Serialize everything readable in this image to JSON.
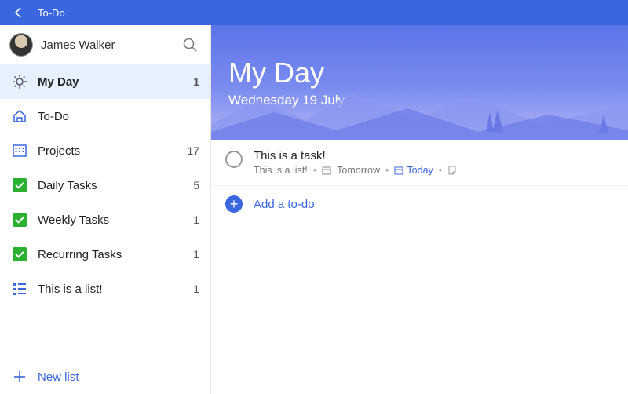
{
  "app": {
    "title": "To-Do"
  },
  "user": {
    "name": "James Walker"
  },
  "sidebar": {
    "items": [
      {
        "label": "My Day",
        "count": "1",
        "icon": "sun",
        "active": true
      },
      {
        "label": "To-Do",
        "count": "",
        "icon": "home"
      },
      {
        "label": "Projects",
        "count": "17",
        "icon": "calendar"
      },
      {
        "label": "Daily Tasks",
        "count": "5",
        "icon": "check"
      },
      {
        "label": "Weekly Tasks",
        "count": "1",
        "icon": "check"
      },
      {
        "label": "Recurring Tasks",
        "count": "1",
        "icon": "check"
      },
      {
        "label": "This is a list!",
        "count": "1",
        "icon": "bullets"
      }
    ],
    "new_list_label": "New list"
  },
  "main": {
    "title": "My Day",
    "date": "Wednesday 19 July",
    "task": {
      "title": "This is a task!",
      "list": "This is a list!",
      "due": "Tomorrow",
      "remind": "Today"
    },
    "add_label": "Add a to-do"
  }
}
